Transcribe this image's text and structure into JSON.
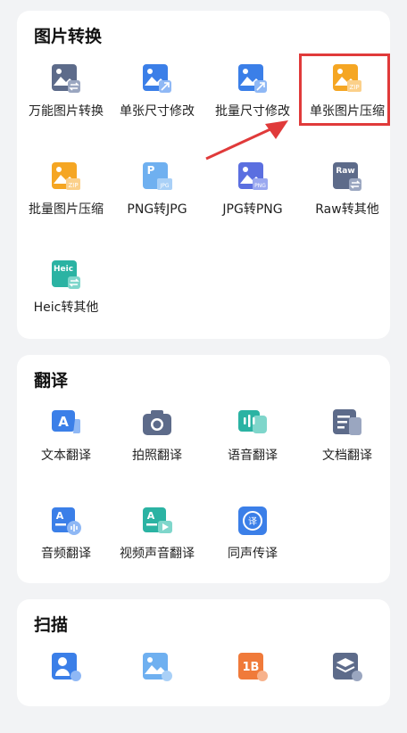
{
  "sections": [
    {
      "title": "图片转换",
      "tools": [
        {
          "label": "万能图片转换",
          "icon": "image-convert-icon"
        },
        {
          "label": "单张尺寸修改",
          "icon": "image-resize-icon"
        },
        {
          "label": "批量尺寸修改",
          "icon": "batch-resize-icon"
        },
        {
          "label": "单张图片压缩",
          "icon": "image-compress-icon"
        },
        {
          "label": "批量图片压缩",
          "icon": "batch-compress-icon"
        },
        {
          "label": "PNG转JPG",
          "icon": "png-to-jpg-icon"
        },
        {
          "label": "JPG转PNG",
          "icon": "jpg-to-png-icon"
        },
        {
          "label": "Raw转其他",
          "icon": "raw-convert-icon"
        },
        {
          "label": "Heic转其他",
          "icon": "heic-convert-icon"
        }
      ]
    },
    {
      "title": "翻译",
      "tools": [
        {
          "label": "文本翻译",
          "icon": "text-translate-icon"
        },
        {
          "label": "拍照翻译",
          "icon": "camera-translate-icon"
        },
        {
          "label": "语音翻译",
          "icon": "voice-translate-icon"
        },
        {
          "label": "文档翻译",
          "icon": "document-translate-icon"
        },
        {
          "label": "音频翻译",
          "icon": "audio-translate-icon"
        },
        {
          "label": "视频声音翻译",
          "icon": "video-translate-icon"
        },
        {
          "label": "同声传译",
          "icon": "simultaneous-interpret-icon"
        }
      ]
    },
    {
      "title": "扫描",
      "tools": [
        {
          "label": "",
          "icon": "id-scan-icon"
        },
        {
          "label": "",
          "icon": "image-scan-icon"
        },
        {
          "label": "",
          "icon": "number-scan-icon"
        },
        {
          "label": "",
          "icon": "layers-scan-icon"
        }
      ]
    }
  ],
  "icon_text": {
    "zip": "ZIP",
    "p": "P",
    "jpg": "JPG",
    "png": "PNG",
    "raw": "Raw",
    "heic": "Heic",
    "a": "A",
    "yi": "译",
    "ib": "1B"
  },
  "colors": {
    "blue": "#3b7fe8",
    "orange": "#f5a623",
    "teal": "#2bb3a3",
    "slate": "#5d6b8a",
    "light_blue": "#6fb0f0",
    "highlight": "#e03a3a"
  }
}
